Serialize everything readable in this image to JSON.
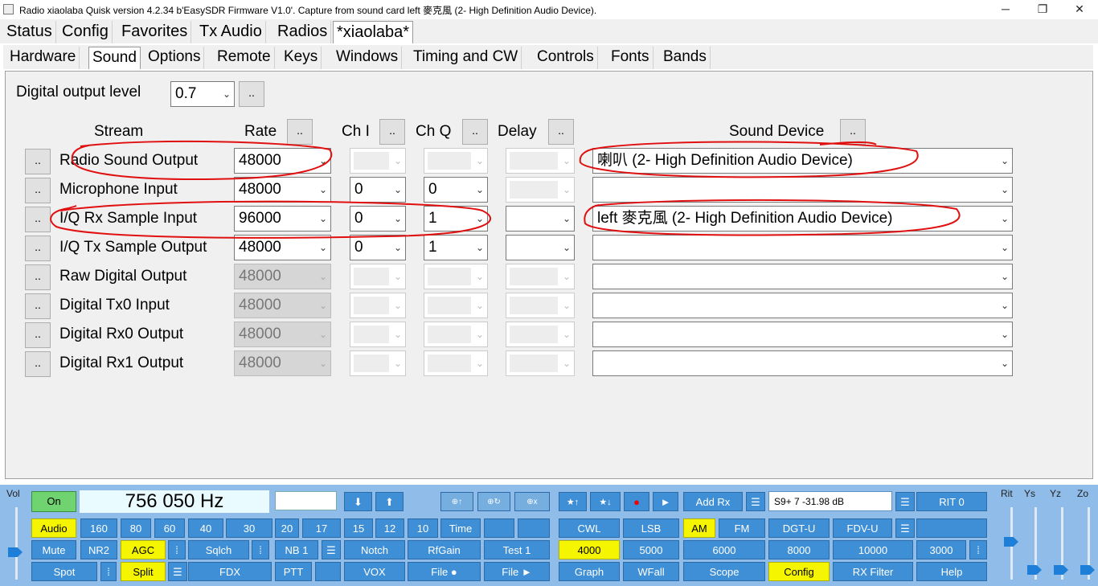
{
  "window": {
    "title": "Radio xiaolaba   Quisk version 4.2.34   b'EasySDR Firmware V1.0'. Capture from sound card left 麥克風 (2- High Definition Audio Device).",
    "minimize": "─",
    "restore": "❐",
    "close": "✕"
  },
  "main_tabs": [
    "Status",
    "Config",
    "Favorites",
    "Tx Audio",
    "Radios",
    "*xiaolaba*"
  ],
  "sub_tabs": [
    "Hardware",
    "Sound",
    "Options",
    "Remote",
    "Keys",
    "Windows",
    "Timing and CW",
    "Controls",
    "Fonts",
    "Bands"
  ],
  "sound": {
    "digital_output_label": "Digital output level",
    "digital_output_value": "0.7",
    "dots": "..",
    "headers": {
      "stream": "Stream",
      "rate": "Rate",
      "chi": "Ch I",
      "chq": "Ch Q",
      "delay": "Delay",
      "device": "Sound Device"
    },
    "rows": [
      {
        "name": "Radio Sound Output",
        "rate": "48000",
        "chi": "",
        "chq": "",
        "delay": "",
        "device": "喇叭 (2- High Definition Audio Device)"
      },
      {
        "name": "Microphone Input",
        "rate": "48000",
        "chi": "0",
        "chq": "0",
        "delay": "",
        "device": ""
      },
      {
        "name": "I/Q Rx Sample Input",
        "rate": "96000",
        "chi": "0",
        "chq": "1",
        "delay": "",
        "device": "left 麥克風 (2- High Definition Audio Device)"
      },
      {
        "name": "I/Q Tx Sample Output",
        "rate": "48000",
        "chi": "0",
        "chq": "1",
        "delay": "",
        "device": ""
      },
      {
        "name": "Raw Digital Output",
        "rate": "48000",
        "chi": "",
        "chq": "",
        "delay": "",
        "device": ""
      },
      {
        "name": "Digital Tx0 Input",
        "rate": "48000",
        "chi": "",
        "chq": "",
        "delay": "",
        "device": ""
      },
      {
        "name": "Digital Rx0 Output",
        "rate": "48000",
        "chi": "",
        "chq": "",
        "delay": "",
        "device": ""
      },
      {
        "name": "Digital Rx1 Output",
        "rate": "48000",
        "chi": "",
        "chq": "",
        "delay": "",
        "device": ""
      }
    ]
  },
  "bottom": {
    "vol": "Vol",
    "on": "On",
    "frequency": "756 050 Hz",
    "smeter": "S9+ 7  -31.98 dB",
    "rit": "RIT 0",
    "rit_label": "Rit",
    "ys": "Ys",
    "yz": "Yz",
    "zo": "Zo",
    "row1_icons": [
      "⬇",
      "⬆",
      "⊕↑",
      "⊕↻",
      "⊕x",
      "★↑",
      "★↓",
      "●",
      "►"
    ],
    "add_rx": "Add Rx",
    "bands": [
      "Audio",
      "160",
      "80",
      "60",
      "40",
      "30",
      "20",
      "17",
      "15",
      "12",
      "10",
      "Time"
    ],
    "row3": [
      "Mute",
      "NR2",
      "AGC",
      "Sqlch",
      "NB 1",
      "Notch",
      "RfGain",
      "Test 1"
    ],
    "row4": [
      "Spot",
      "Split",
      "FDX",
      "PTT",
      "VOX",
      "File ●",
      "File ►"
    ],
    "modes": [
      "CWL",
      "LSB",
      "AM",
      "FM",
      "DGT-U",
      "FDV-U"
    ],
    "filters": [
      "4000",
      "5000",
      "6000",
      "8000",
      "10000",
      "3000"
    ],
    "row4b": [
      "Graph",
      "WFall",
      "Scope",
      "Config",
      "RX Filter",
      "Help"
    ],
    "colors": {
      "button": "#3f8fd6",
      "active": "#f5f500",
      "background": "#8fbce8",
      "on": "#6fd36f"
    }
  }
}
